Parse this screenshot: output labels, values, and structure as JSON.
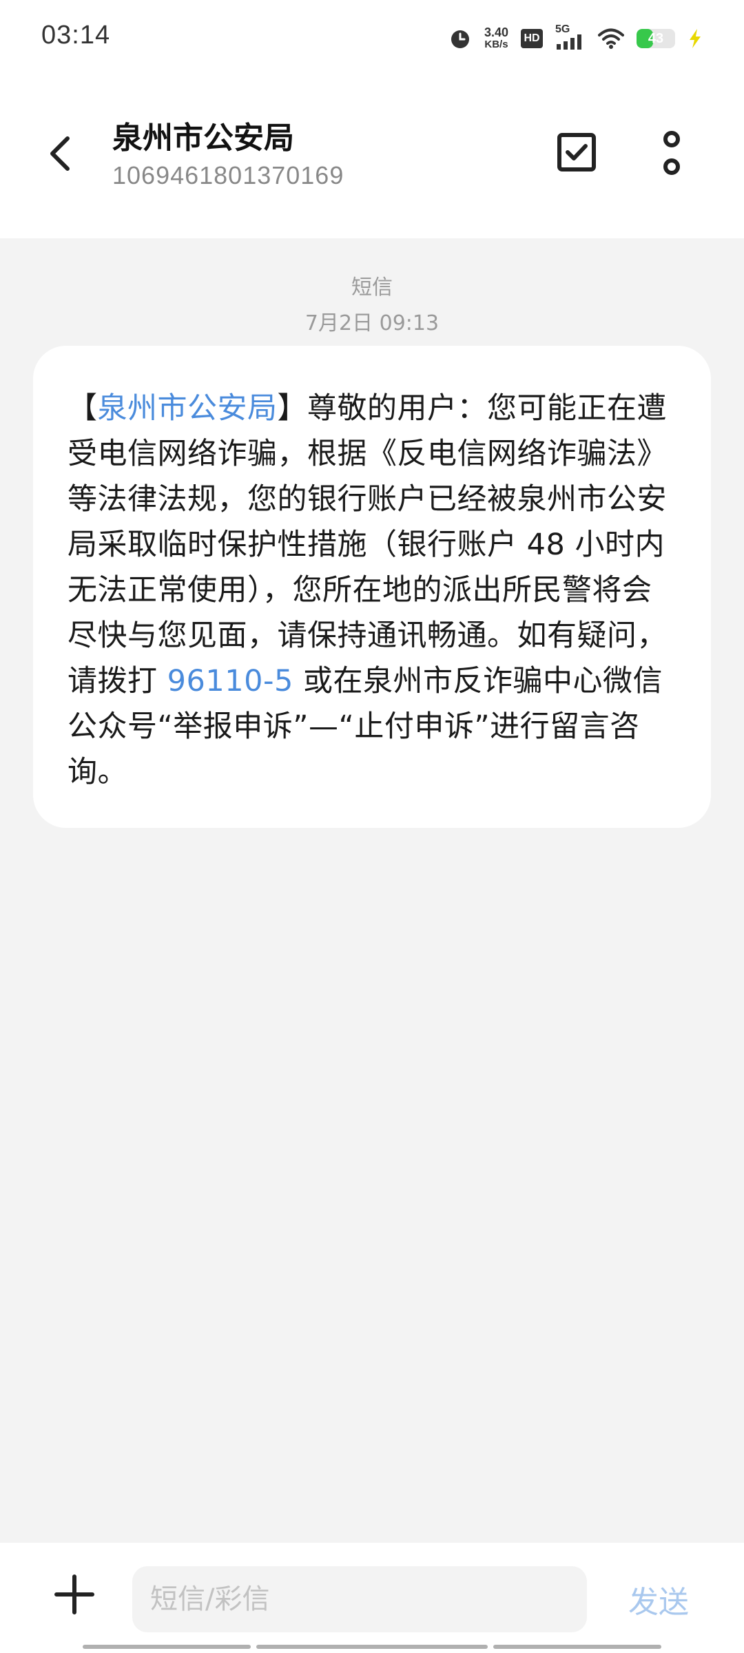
{
  "status_bar": {
    "time": "03:14",
    "speed_value": "3.40",
    "speed_unit": "KB/s",
    "hd_label": "HD",
    "network": "5G",
    "battery_level": "43",
    "battery_fraction": 0.43,
    "icons": [
      "alarm-icon",
      "hd-icon",
      "signal-icon",
      "wifi-icon",
      "battery-icon",
      "charging-icon"
    ]
  },
  "header": {
    "title": "泉州市公安局",
    "number": "1069461801370169"
  },
  "conversation": {
    "message_type": "短信",
    "date": "7月2日 09:13"
  },
  "message": {
    "part_open": "【",
    "sender_link": "泉州市公安局",
    "part_1": "】尊敬的用户：您可能正在遭受电信网络诈骗，根据《反电信网络诈骗法》等法律法规，您的银行账户已经被泉州市公安局采取临时保护性措施（银行账户 48 小时内无法正常使用），您所在地的派出所民警将会尽快与您见面，请保持通讯畅通。如有疑问，请拨打 ",
    "phone_link": "96110-5",
    "part_2": " 或在泉州市反诈骗中心微信公众号“举报申诉”—“止付申诉”进行留言咨询。"
  },
  "input_bar": {
    "placeholder": "短信/彩信",
    "send_label": "发送"
  },
  "colors": {
    "accent": "#4a8bdc",
    "send_disabled": "#a9c8ee",
    "battery": "#37c84b",
    "charging": "#e8d800"
  }
}
